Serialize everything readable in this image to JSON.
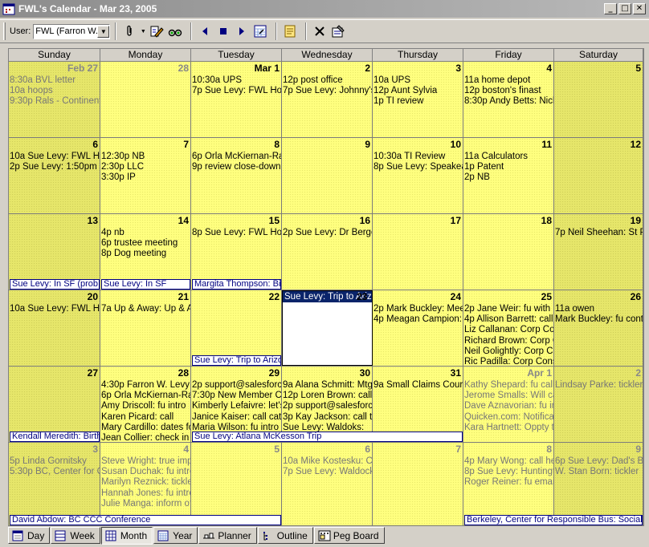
{
  "window": {
    "title": "FWL's Calendar - Mar 23, 2005",
    "min": "_",
    "max": "□",
    "close": "✕"
  },
  "toolbar": {
    "user_label": "User:",
    "user_value": "FWL (Farron W."
  },
  "day_headers": [
    "Sunday",
    "Monday",
    "Tuesday",
    "Wednesday",
    "Thursday",
    "Friday",
    "Saturday"
  ],
  "weeks": [
    {
      "days": [
        {
          "num": "Feb 27",
          "other": true,
          "wkend": true,
          "events": [
            "8:30a BVL letter",
            "10a hoops",
            "9:30p Rals - Continental"
          ]
        },
        {
          "num": "28",
          "other": true,
          "events": []
        },
        {
          "num": "Mar 1",
          "events": [
            "10:30a UPS",
            "7p Sue Levy: FWL Hoop"
          ]
        },
        {
          "num": "2",
          "events": [
            "12p post office",
            "7p Sue Levy: Johnny's"
          ]
        },
        {
          "num": "3",
          "events": [
            "10a UPS",
            "12p Aunt Sylvia",
            "1p TI review"
          ]
        },
        {
          "num": "4",
          "events": [
            "11a home depot",
            "12p boston's finast",
            "8:30p Andy Betts: Nick'"
          ]
        },
        {
          "num": "5",
          "wkend": true,
          "events": []
        }
      ],
      "banners": []
    },
    {
      "days": [
        {
          "num": "6",
          "wkend": true,
          "events": [
            "10a Sue Levy: FWL Hoo",
            "2p Sue Levy: 1:50pm M"
          ]
        },
        {
          "num": "7",
          "events": [
            "12:30p NB",
            "2:30p LLC",
            "3:30p IP"
          ]
        },
        {
          "num": "8",
          "events": [
            "6p Orla McKiernan-Raft",
            "9p review close-down p"
          ]
        },
        {
          "num": "9",
          "events": []
        },
        {
          "num": "10",
          "events": [
            "10:30a TI Review",
            "8p Sue Levy: Speakea"
          ]
        },
        {
          "num": "11",
          "events": [
            "11a Calculators",
            "1p Patent",
            "2p NB"
          ]
        },
        {
          "num": "12",
          "wkend": true,
          "events": []
        }
      ],
      "banners": []
    },
    {
      "days": [
        {
          "num": "13",
          "wkend": true,
          "events": []
        },
        {
          "num": "14",
          "events": [
            "4p nb",
            "6p trustee meeting",
            "8p Dog meeting"
          ]
        },
        {
          "num": "15",
          "events": [
            "8p Sue Levy: FWL Hoo"
          ]
        },
        {
          "num": "16",
          "events": [
            "2p Sue Levy: Dr Berger"
          ]
        },
        {
          "num": "17",
          "events": []
        },
        {
          "num": "18",
          "events": []
        },
        {
          "num": "19",
          "wkend": true,
          "events": [
            "7p Neil Sheehan: St Pa"
          ]
        }
      ],
      "banners": [
        {
          "text": "Sue Levy: In SF (prob li",
          "start": 0,
          "span": 1
        },
        {
          "text": "Sue Levy: In SF",
          "start": 1,
          "span": 1
        },
        {
          "text": "Margita Thompson: Birt",
          "start": 2,
          "span": 1
        }
      ]
    },
    {
      "days": [
        {
          "num": "20",
          "wkend": true,
          "events": [
            "10a Sue Levy: FWL Ho"
          ]
        },
        {
          "num": "21",
          "events": [
            "7a Up & Away: Up & Aw"
          ]
        },
        {
          "num": "22",
          "events": []
        },
        {
          "num": "23",
          "selected": true,
          "events": []
        },
        {
          "num": "24",
          "events": [
            "2p Mark Buckley: Meet",
            "4p Meagan Campion: B"
          ]
        },
        {
          "num": "25",
          "events": [
            "2p Jane Weir: fu with R",
            "4p Allison Barrett: call c",
            "Liz Callanan: Corp Cons",
            "Richard Brown: Corp Co",
            "Neil Golightly: Corp Con",
            "Ric Padilla: Corp Consu"
          ]
        },
        {
          "num": "26",
          "wkend": true,
          "events": [
            "11a owen",
            "Mark Buckley: fu conta"
          ]
        }
      ],
      "banners": [
        {
          "text": "Sue Levy: Trip to Arizon",
          "start": 2,
          "span": 1
        }
      ],
      "popup": "Sue Levy: Trip to Arizo"
    },
    {
      "days": [
        {
          "num": "27",
          "wkend": true,
          "events": []
        },
        {
          "num": "28",
          "events": [
            "4:30p Farron W. Levy: f",
            "6p Orla McKiernan-Raft",
            "Amy Driscoll: fu intro",
            "Karen Picard: call",
            "Mary Cardillo: dates for",
            "Jean Collier: check in to"
          ]
        },
        {
          "num": "29",
          "events": [
            "2p support@salesforce.",
            "7:30p New Member Co",
            "Kimberly Lefaivre: let's",
            "Janice Kaiser: call catch",
            "Maria Wilson: fu intro -"
          ]
        },
        {
          "num": "30",
          "events": [
            "9a Alana Schmitt: Mtg w",
            "12p Loren Brown: call to",
            "2p support@salesforce.",
            "3p Kay Jackson: call to",
            "Sue Levy: Waldoks:"
          ]
        },
        {
          "num": "31",
          "events": [
            "9a Small Claims Court"
          ]
        },
        {
          "num": "Apr 1",
          "other": true,
          "events": [
            "Kathy Shepard: fu call",
            "Jerome Smalls: Will call",
            "Dave Aznavorian: fu int",
            "Quicken.com: Notificati",
            "Kara Hartnett: Oppty to"
          ]
        },
        {
          "num": "2",
          "other": true,
          "wkend": true,
          "events": [
            "Lindsay Parke: tickler"
          ]
        }
      ],
      "banners": [
        {
          "text": "Kendall Meredith: Birthd",
          "start": 0,
          "span": 1
        },
        {
          "text": "Sue Levy: Atlana McKesson Trip",
          "start": 2,
          "span": 3
        }
      ]
    },
    {
      "days": [
        {
          "num": "3",
          "other": true,
          "wkend": true,
          "events": [
            "5p Linda Gornitsky",
            "5:30p BC, Center for Co"
          ]
        },
        {
          "num": "4",
          "other": true,
          "events": [
            "Steve Wright: true impa",
            "Susan Duchak: fu intro",
            "Marilyn Reznick: tickler",
            "Hannah Jones: fu intro",
            "Julie Manga: inform of t"
          ]
        },
        {
          "num": "5",
          "other": true,
          "events": []
        },
        {
          "num": "6",
          "other": true,
          "events": [
            "10a Mike Kostesku: Cal",
            "7p Sue Levy: Waldocks"
          ]
        },
        {
          "num": "7",
          "other": true,
          "events": []
        },
        {
          "num": "8",
          "other": true,
          "events": [
            "4p Mary Wong: call her",
            "8p Sue Levy: Huntingto",
            "Roger Reiner: fu email e"
          ]
        },
        {
          "num": "9",
          "other": true,
          "wkend": true,
          "events": [
            "6p Sue Levy: Dad's Birt",
            "W. Stan Born: tickler"
          ]
        }
      ],
      "banners": [
        {
          "text": "David Abdow: BC CCC Conference",
          "start": 0,
          "span": 3
        },
        {
          "text": "Berkeley, Center for Responsible Bus: Social Pe",
          "start": 5,
          "span": 2
        }
      ]
    }
  ],
  "tabs": [
    {
      "label": "Day",
      "icon": "day-view-icon"
    },
    {
      "label": "Week",
      "icon": "week-view-icon"
    },
    {
      "label": "Month",
      "icon": "month-view-icon",
      "active": true
    },
    {
      "label": "Year",
      "icon": "year-view-icon"
    },
    {
      "label": "Planner",
      "icon": "planner-icon"
    },
    {
      "label": "Outline",
      "icon": "outline-icon"
    },
    {
      "label": "Peg Board",
      "icon": "peg-board-icon"
    }
  ]
}
